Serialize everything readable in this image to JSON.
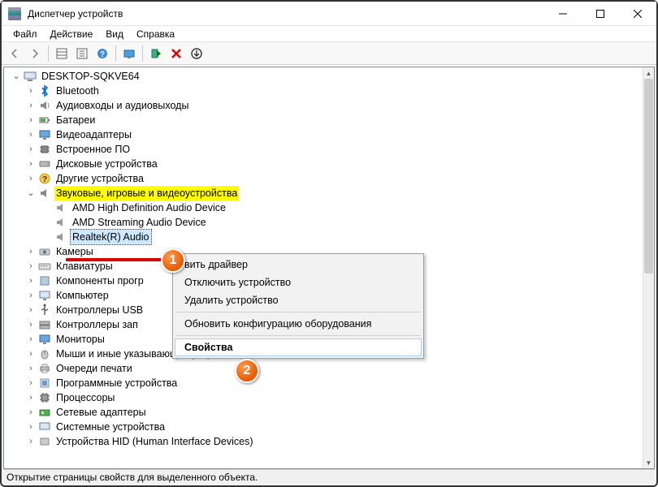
{
  "window": {
    "title": "Диспетчер устройств"
  },
  "menu": {
    "file": "Файл",
    "action": "Действие",
    "view": "Вид",
    "help": "Справка"
  },
  "tree": {
    "root": "DESKTOP-SQKVE64",
    "bluetooth": "Bluetooth",
    "audio_io": "Аудиовходы и аудиовыходы",
    "batteries": "Батареи",
    "display": "Видеоадаптеры",
    "firmware": "Встроенное ПО",
    "disk": "Дисковые устройства",
    "other": "Другие устройства",
    "sound_cat": "Звуковые, игровые и видеоустройства",
    "sound_amd_hd": "AMD High Definition Audio Device",
    "sound_amd_stream": "AMD Streaming Audio Device",
    "sound_realtek": "Realtek(R) Audio",
    "cameras": "Камеры",
    "keyboards": "Клавиатуры",
    "components": "Компоненты прогр",
    "computer": "Компьютер",
    "usb": "Контроллеры USB",
    "storage_ctrl": "Контроллеры зап",
    "monitors": "Мониторы",
    "mice": "Мыши и иные указывающие устройства",
    "print_queues": "Очереди печати",
    "software_dev": "Программные устройства",
    "cpus": "Процессоры",
    "net": "Сетевые адаптеры",
    "system": "Системные устройства",
    "hid": "Устройства HID (Human Interface Devices)"
  },
  "context": {
    "update": "вить драйвер",
    "disable": "Отключить устройство",
    "uninstall": "Удалить устройство",
    "scan": "Обновить конфигурацию оборудования",
    "properties": "Свойства"
  },
  "status": "Открытие страницы свойств для выделенного объекта."
}
